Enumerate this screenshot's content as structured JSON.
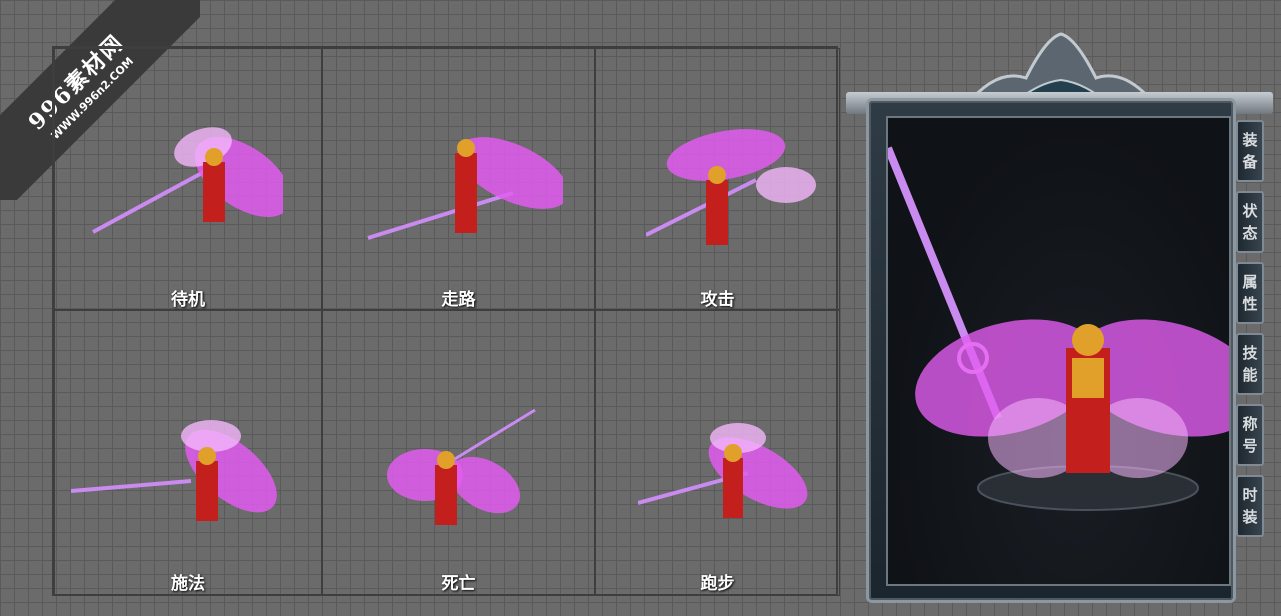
{
  "watermark": {
    "title": "996素材网",
    "url": "WWW.996n2.COM"
  },
  "animations": [
    {
      "label": "待机"
    },
    {
      "label": "走路"
    },
    {
      "label": "攻击"
    },
    {
      "label": "施法"
    },
    {
      "label": "死亡"
    },
    {
      "label": "跑步"
    }
  ],
  "side_tabs": [
    {
      "c1": "装",
      "c2": "备"
    },
    {
      "c1": "状",
      "c2": "态"
    },
    {
      "c1": "属",
      "c2": "性"
    },
    {
      "c1": "技",
      "c2": "能"
    },
    {
      "c1": "称",
      "c2": "号"
    },
    {
      "c1": "时",
      "c2": "装"
    }
  ],
  "colors": {
    "wing": "#e25cf0",
    "wing_light": "#f4b6fb",
    "armor_red": "#c3201d",
    "armor_gold": "#e0a02a",
    "sword": "#c98bf0"
  }
}
